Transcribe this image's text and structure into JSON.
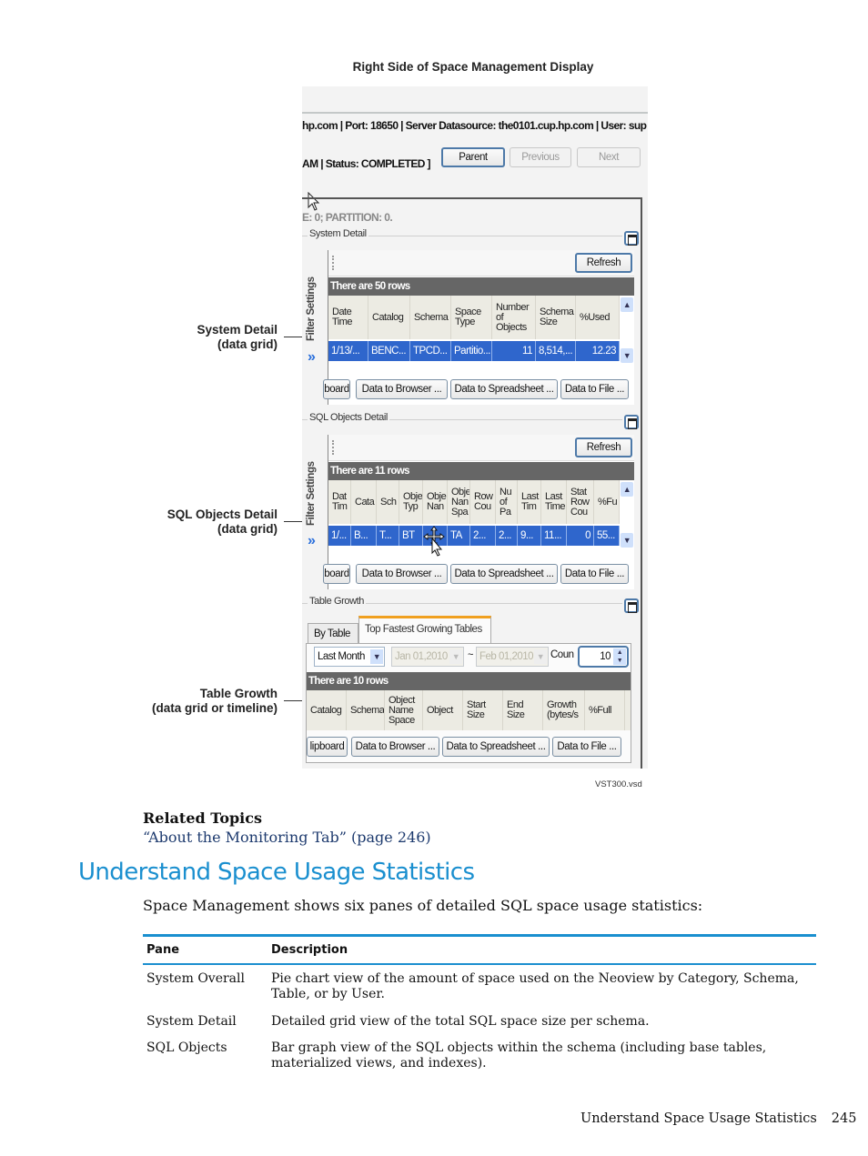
{
  "figure": {
    "title": "Right Side of Space Management Display",
    "file_label": "VST300.vsd",
    "callouts": [
      {
        "line1": "System Detail",
        "line2": "(data grid)"
      },
      {
        "line1": "SQL Objects Detail",
        "line2": "(data grid)"
      },
      {
        "line1": "Table Growth",
        "line2": "(data grid or timeline)"
      }
    ],
    "screenshot": {
      "connection_text": "hp.com | Port: 18650 | Server Datasource: the0101.cup.hp.com | User: sup",
      "status_text": "AM | Status: COMPLETED ]",
      "nav_buttons": {
        "parent": "Parent",
        "previous": "Previous",
        "next": "Next"
      },
      "partition_text": "E: 0; PARTITION: 0.",
      "filter_settings_label": "Filter Settings",
      "system_detail": {
        "group_label": "System Detail",
        "refresh_label": "Refresh",
        "rows_text": "There are 50 rows",
        "columns": [
          "Date Time",
          "Catalog",
          "Schema",
          "Space Type",
          "Number of Objects",
          "Schema Size",
          "%Used"
        ],
        "row": [
          "1/13/...",
          "BENC...",
          "TPCD...",
          "Partitio...",
          "11",
          "8,514,...",
          "12.23"
        ],
        "export_buttons": [
          "board",
          "Data to Browser ...",
          "Data to Spreadsheet ...",
          "Data to File ..."
        ]
      },
      "sql_objects_detail": {
        "group_label": "SQL Objects Detail",
        "refresh_label": "Refresh",
        "rows_text": "There are 11 rows",
        "columns": [
          "Dat Tim",
          "Cata",
          "Sch",
          "Obje Typ",
          "Obje Nan",
          "Obje Nan Spa",
          "Row Cou",
          "Nu of Pa",
          "Last Tim",
          "Last Time",
          "Stat Row Cou",
          "%Fu"
        ],
        "row": [
          "1/...",
          "B...",
          "T...",
          "BT",
          "",
          "TA",
          "2...",
          "2...",
          "9...",
          "11...",
          "0",
          "55..."
        ],
        "export_buttons": [
          "board",
          "Data to Browser ...",
          "Data to Spreadsheet ...",
          "Data to File ..."
        ]
      },
      "table_growth": {
        "group_label": "Table Growth",
        "tabs": [
          "By Table",
          "Top Fastest Growing Tables"
        ],
        "active_tab": "Top Fastest Growing Tables",
        "period_value": "Last Month",
        "start_date": "Jan 01,2010",
        "end_date": "Feb 01,2010",
        "count_label": "Coun",
        "count_value": "10",
        "rows_text": "There are 10 rows",
        "columns": [
          "Catalog",
          "Schema",
          "Object Name Space",
          "Object",
          "Start Size",
          "End Size",
          "Growth (bytes/s",
          "%Full"
        ],
        "export_buttons": [
          "lipboard",
          "Data to Browser ...",
          "Data to Spreadsheet ...",
          "Data to File ..."
        ]
      }
    }
  },
  "related_topics": {
    "heading": "Related Topics",
    "link": "“About the Monitoring Tab” (page 246)"
  },
  "section": {
    "title": "Understand Space Usage Statistics",
    "intro": "Space Management shows six panes of detailed SQL space usage statistics:"
  },
  "table": {
    "headers": [
      "Pane",
      "Description"
    ],
    "rows": [
      [
        "System Overall",
        "Pie chart view of the amount of space used on the Neoview by Category, Schema, Table, or by User."
      ],
      [
        "System Detail",
        "Detailed grid view of the total SQL space size per schema."
      ],
      [
        "SQL Objects",
        "Bar graph view of the SQL objects within the schema (including base tables, materialized views, and indexes)."
      ]
    ]
  },
  "footer": {
    "running_title": "Understand Space Usage Statistics",
    "page_number": "245"
  },
  "colors": {
    "heading_blue": "#1a8fcf",
    "link_navy": "#1d3a6e",
    "selection_blue": "#2f66cc",
    "rows_bar_gray": "#666666",
    "active_tab_accent": "#f0a020"
  }
}
